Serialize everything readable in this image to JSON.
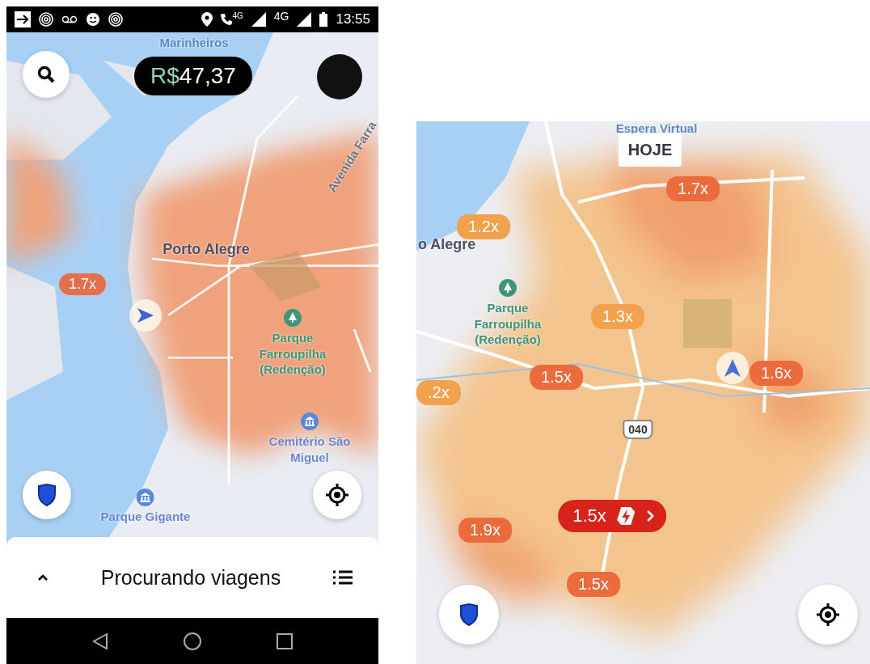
{
  "left_screen": {
    "status_bar": {
      "network_labels": [
        "4G",
        "4G"
      ],
      "time": "13:55"
    },
    "earnings": {
      "currency": "R$",
      "amount": "47,37"
    },
    "map_labels": [
      {
        "text": "Marinheiros",
        "kind": "water"
      },
      {
        "text": "Avenida Farra",
        "kind": "road"
      },
      {
        "text": "Porto Alegre",
        "kind": "city"
      },
      {
        "text": "Parque Farroupilha (Redenção)",
        "kind": "park"
      },
      {
        "text": "Cemitério São Miguel",
        "kind": "poi"
      },
      {
        "text": "Parque Gigante",
        "kind": "poi"
      }
    ],
    "surge_badges": [
      {
        "text": "1.7x",
        "color": "#e36f4c"
      }
    ],
    "bottom_sheet": {
      "title": "Procurando viagens"
    }
  },
  "right_screen": {
    "map_labels": [
      {
        "text": "Espera Virtual",
        "kind": "water"
      },
      {
        "text": "HOJE",
        "kind": "tag"
      },
      {
        "text": "o Alegre",
        "kind": "city"
      },
      {
        "text": "Parque Farroupilha (Redenção)",
        "kind": "park"
      },
      {
        "text": "040",
        "kind": "shield"
      }
    ],
    "surge_badges": [
      {
        "text": "1.7x",
        "color": "#ec6b3c",
        "kind": "surge"
      },
      {
        "text": "1.2x",
        "color": "#f2a24c",
        "kind": "surge"
      },
      {
        "text": "1.3x",
        "color": "#f2a24c",
        "kind": "surge"
      },
      {
        "text": "1.5x",
        "color": "#ec6b3c",
        "kind": "surge"
      },
      {
        "text": "1.6x",
        "color": "#ec6b3c",
        "kind": "surge"
      },
      {
        "text": ".2x",
        "color": "#f2a24c",
        "kind": "surge"
      },
      {
        "text": "1.5x",
        "color": "#d8231b",
        "kind": "boost"
      },
      {
        "text": "1.9x",
        "color": "#ec6b3c",
        "kind": "surge"
      },
      {
        "text": "1.5x",
        "color": "#ec6b3c",
        "kind": "surge"
      }
    ]
  }
}
